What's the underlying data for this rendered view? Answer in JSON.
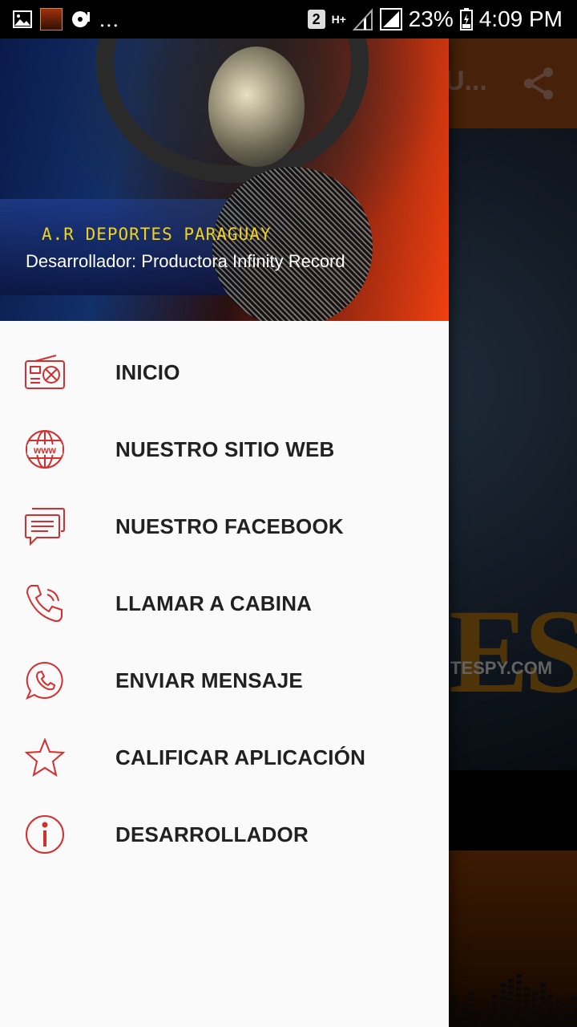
{
  "status_bar": {
    "sim_slot": "2",
    "network": "H+",
    "battery": "23%",
    "time": "4:09 PM",
    "overflow": "..."
  },
  "background_app": {
    "title_truncated": "U...",
    "hero_text": "ES",
    "hero_url": "TESPY.COM",
    "toolbar_color": "#7a3a10"
  },
  "drawer": {
    "header": {
      "app_name": "A.R DEPORTES PARAGUAY",
      "developer_line": "Desarrollador: Productora Infinity Record"
    },
    "accent_color": "#d32f2f",
    "items": [
      {
        "label": "INICIO",
        "icon": "radio-icon"
      },
      {
        "label": "NUESTRO SITIO WEB",
        "icon": "www-globe-icon"
      },
      {
        "label": "NUESTRO FACEBOOK",
        "icon": "chat-bubbles-icon"
      },
      {
        "label": "LLAMAR A CABINA",
        "icon": "phone-icon"
      },
      {
        "label": "ENVIAR MENSAJE",
        "icon": "whatsapp-icon"
      },
      {
        "label": "CALIFICAR APLICACIÓN",
        "icon": "star-icon"
      },
      {
        "label": "DESARROLLADOR",
        "icon": "info-icon"
      }
    ]
  }
}
